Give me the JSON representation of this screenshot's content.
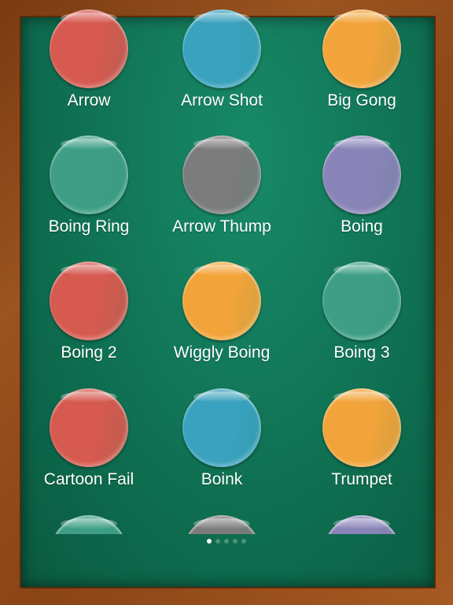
{
  "colors": {
    "red": "#d65a50",
    "blue": "#3aa2be",
    "orange": "#f2a43a",
    "teal": "#3e9f86",
    "gray": "#7c7c7c",
    "purple": "#8a84b8"
  },
  "sounds": [
    {
      "label": "Arrow",
      "color": "red"
    },
    {
      "label": "Arrow Shot",
      "color": "blue"
    },
    {
      "label": "Big Gong",
      "color": "orange"
    },
    {
      "label": "Boing Ring",
      "color": "teal"
    },
    {
      "label": "Arrow Thump",
      "color": "gray"
    },
    {
      "label": "Boing",
      "color": "purple"
    },
    {
      "label": "Boing 2",
      "color": "red"
    },
    {
      "label": "Wiggly Boing",
      "color": "orange"
    },
    {
      "label": "Boing 3",
      "color": "teal"
    },
    {
      "label": "Cartoon Fail",
      "color": "red"
    },
    {
      "label": "Boink",
      "color": "blue"
    },
    {
      "label": "Trumpet",
      "color": "orange"
    },
    {
      "label": "",
      "color": "teal"
    },
    {
      "label": "",
      "color": "gray"
    },
    {
      "label": "",
      "color": "purple"
    }
  ],
  "pager": {
    "pages": 5,
    "current": 1
  }
}
